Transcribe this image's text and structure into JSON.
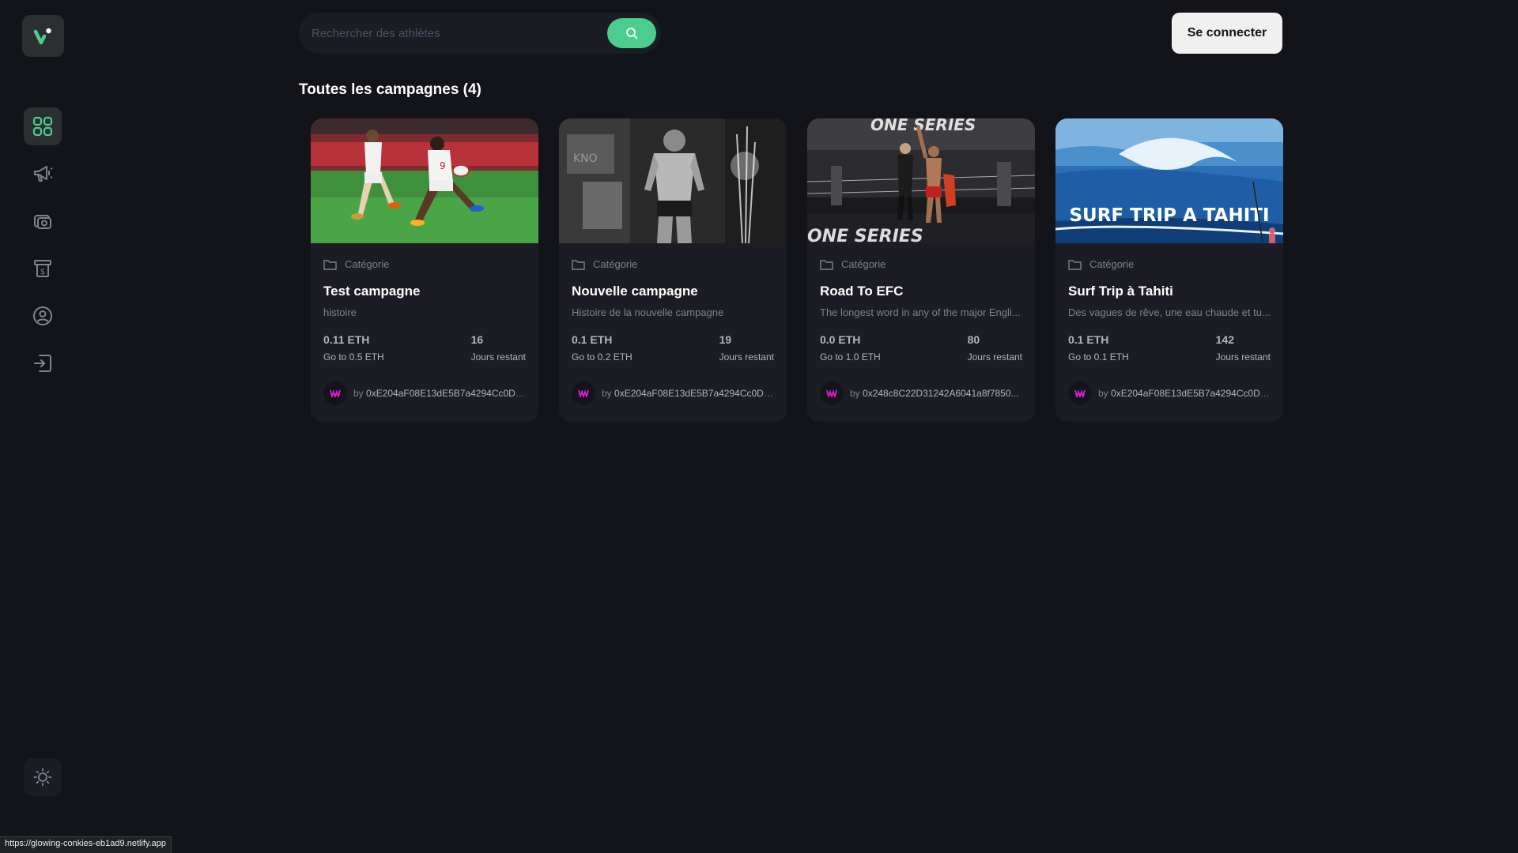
{
  "sidebar": {
    "logo": "v-logo-icon",
    "items": [
      {
        "name": "dashboard",
        "icon": "grid-icon",
        "active": true
      },
      {
        "name": "campaigns",
        "icon": "megaphone-icon",
        "active": false
      },
      {
        "name": "payment",
        "icon": "camera-wallet-icon",
        "active": false
      },
      {
        "name": "withdraw",
        "icon": "cash-icon",
        "active": false
      },
      {
        "name": "profile",
        "icon": "user-circle-icon",
        "active": false
      },
      {
        "name": "logout",
        "icon": "logout-icon",
        "active": false
      }
    ],
    "theme_icon": "sun-icon"
  },
  "header": {
    "search_placeholder": "Rechercher des athlètes",
    "search_icon": "search-icon",
    "connect_label": "Se connecter"
  },
  "main": {
    "title": "Toutes les campagnes (4)",
    "cards": [
      {
        "category": "Catégorie",
        "title": "Test campagne",
        "description": "histoire",
        "raised": "0.11 ETH",
        "target": "Go to 0.5 ETH",
        "days": "16",
        "days_label": "Jours restant",
        "owner_prefix": "by",
        "owner": "0xE204aF08E13dE5B7a4294Cc0D1...",
        "image": "rugby"
      },
      {
        "category": "Catégorie",
        "title": "Nouvelle campagne",
        "description": "Histoire de la nouvelle campagne",
        "raised": "0.1 ETH",
        "target": "Go to 0.2 ETH",
        "days": "19",
        "days_label": "Jours restant",
        "owner_prefix": "by",
        "owner": "0xE204aF08E13dE5B7a4294Cc0D1...",
        "image": "fighter"
      },
      {
        "category": "Catégorie",
        "title": "Road To EFC",
        "description": "The longest word in any of the major Engli...",
        "raised": "0.0 ETH",
        "target": "Go to 1.0 ETH",
        "days": "80",
        "days_label": "Jours restant",
        "owner_prefix": "by",
        "owner": "0x248c8C22D31242A6041a8f7850...",
        "image": "ring"
      },
      {
        "category": "Catégorie",
        "title": "Surf Trip à Tahiti",
        "description": "Des vagues de rêve, une eau chaude et tu...",
        "raised": "0.1 ETH",
        "target": "Go to 0.1 ETH",
        "days": "142",
        "days_label": "Jours restant",
        "owner_prefix": "by",
        "owner": "0xE204aF08E13dE5B7a4294Cc0D1...",
        "image": "surf",
        "image_text": "SURF TRIP A TAHITI"
      }
    ]
  },
  "card_images": {
    "ring_banner": "ONE SERIES",
    "ring_floor": "ONE SERIES",
    "fighter_banner": "KNO"
  },
  "status_bar": {
    "url": "https://glowing-conkies-eb1ad9.netlify.app"
  },
  "colors": {
    "background": "#13131a",
    "card": "#1c1c24",
    "accent": "#4acd8d",
    "muted": "#808191"
  }
}
